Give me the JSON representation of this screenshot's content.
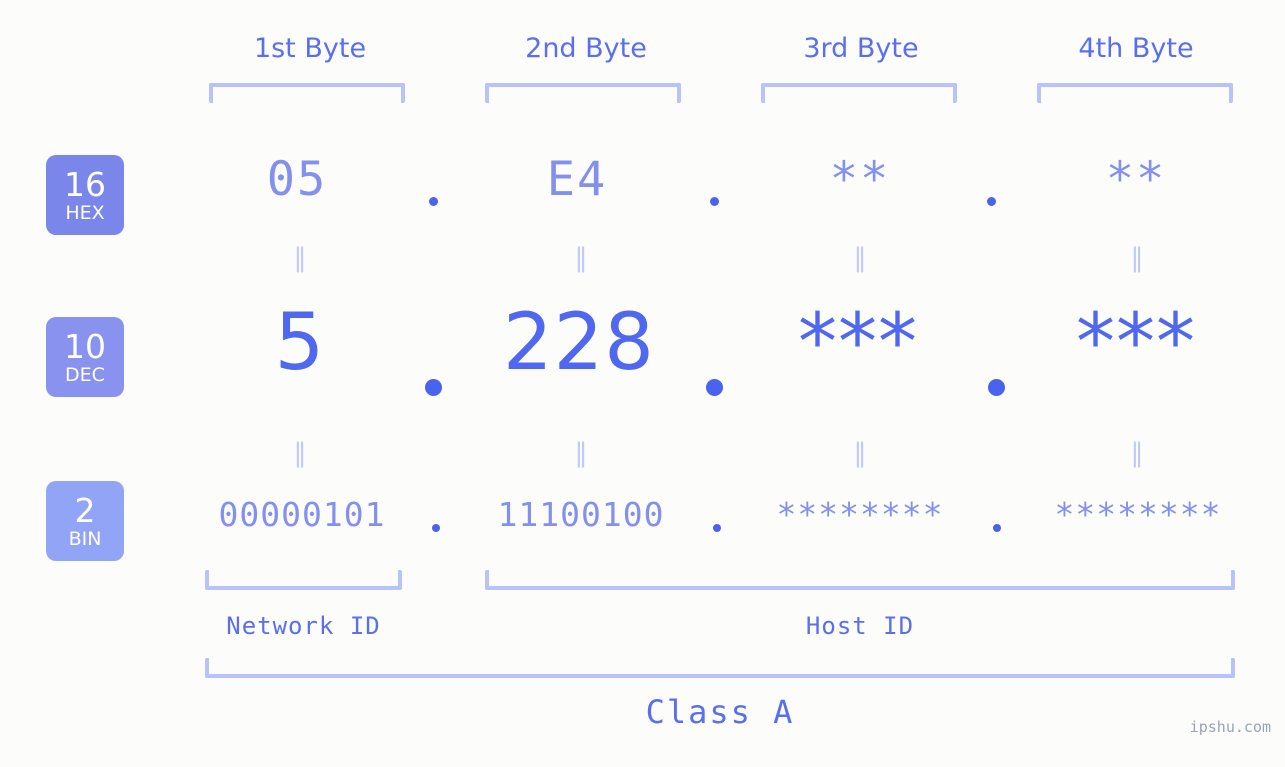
{
  "watermark": "ipshu.com",
  "colors": {
    "background": "#fcfdfa",
    "accent": "#5a6ef0",
    "value": "#8490ee",
    "dec_value": "#5068ef",
    "bracket": "#b9c2fb",
    "badge_hex": "#7a86ea",
    "badge_dec": "#8993ef",
    "badge_bin": "#92a4f5",
    "equals": "#c2caf9",
    "watermark": "#9aa3b8"
  },
  "headers": [
    {
      "label": "1st Byte"
    },
    {
      "label": "2nd Byte"
    },
    {
      "label": "3rd Byte"
    },
    {
      "label": "4th Byte"
    }
  ],
  "radix_badges": [
    {
      "number": "16",
      "name": "HEX"
    },
    {
      "number": "10",
      "name": "DEC"
    },
    {
      "number": "2",
      "name": "BIN"
    }
  ],
  "rows": {
    "hex": {
      "radix": "16",
      "radix_name": "HEX",
      "values": [
        "05",
        "E4",
        "**",
        "**"
      ]
    },
    "dec": {
      "radix": "10",
      "radix_name": "DEC",
      "values": [
        "5",
        "228",
        "***",
        "***"
      ]
    },
    "bin": {
      "radix": "2",
      "radix_name": "BIN",
      "values": [
        "00000101",
        "11100100",
        "********",
        "********"
      ]
    }
  },
  "separators": {
    "symbol": ".",
    "count": 3
  },
  "equality_marks": {
    "symbol": "=",
    "between_hex_dec": [
      "=",
      "=",
      "=",
      "="
    ],
    "between_dec_bin": [
      "=",
      "=",
      "=",
      "="
    ]
  },
  "segments": {
    "network_id": "Network ID",
    "host_id": "Host ID",
    "class": "Class A"
  }
}
